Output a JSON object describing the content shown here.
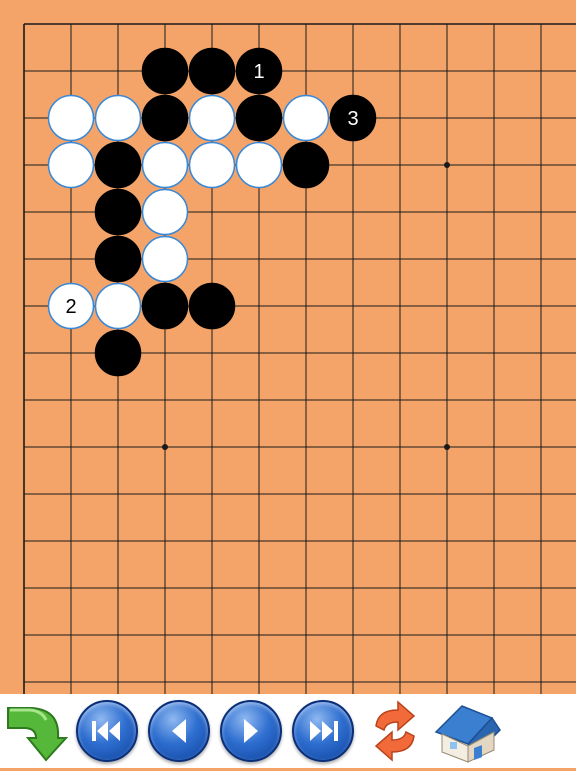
{
  "board": {
    "size": 19,
    "background_color": "#f4a468",
    "line_color": "#1a1a1a",
    "star_points": [
      [
        9,
        3
      ],
      [
        3,
        9
      ],
      [
        9,
        9
      ]
    ],
    "stones": [
      {
        "color": "black",
        "col": 3,
        "row": 1,
        "label": ""
      },
      {
        "color": "black",
        "col": 4,
        "row": 1,
        "label": ""
      },
      {
        "color": "black",
        "col": 5,
        "row": 1,
        "label": "1"
      },
      {
        "color": "white",
        "col": 1,
        "row": 2,
        "label": ""
      },
      {
        "color": "white",
        "col": 2,
        "row": 2,
        "label": ""
      },
      {
        "color": "black",
        "col": 3,
        "row": 2,
        "label": ""
      },
      {
        "color": "white",
        "col": 4,
        "row": 2,
        "label": ""
      },
      {
        "color": "black",
        "col": 5,
        "row": 2,
        "label": ""
      },
      {
        "color": "white",
        "col": 6,
        "row": 2,
        "label": ""
      },
      {
        "color": "black",
        "col": 7,
        "row": 2,
        "label": "3"
      },
      {
        "color": "white",
        "col": 1,
        "row": 3,
        "label": ""
      },
      {
        "color": "black",
        "col": 2,
        "row": 3,
        "label": ""
      },
      {
        "color": "white",
        "col": 3,
        "row": 3,
        "label": ""
      },
      {
        "color": "white",
        "col": 4,
        "row": 3,
        "label": ""
      },
      {
        "color": "white",
        "col": 5,
        "row": 3,
        "label": ""
      },
      {
        "color": "black",
        "col": 6,
        "row": 3,
        "label": ""
      },
      {
        "color": "black",
        "col": 2,
        "row": 4,
        "label": ""
      },
      {
        "color": "white",
        "col": 3,
        "row": 4,
        "label": ""
      },
      {
        "color": "black",
        "col": 2,
        "row": 5,
        "label": ""
      },
      {
        "color": "white",
        "col": 3,
        "row": 5,
        "label": ""
      },
      {
        "color": "white",
        "col": 1,
        "row": 6,
        "label": "2"
      },
      {
        "color": "white",
        "col": 2,
        "row": 6,
        "label": ""
      },
      {
        "color": "black",
        "col": 3,
        "row": 6,
        "label": ""
      },
      {
        "color": "black",
        "col": 4,
        "row": 6,
        "label": ""
      },
      {
        "color": "black",
        "col": 2,
        "row": 7,
        "label": ""
      }
    ]
  },
  "toolbar": {
    "buttons": [
      {
        "name": "undo-button",
        "icon": "curved-arrow-icon"
      },
      {
        "name": "first-move-button",
        "icon": "skip-to-start-icon"
      },
      {
        "name": "previous-move-button",
        "icon": "step-back-icon"
      },
      {
        "name": "next-move-button",
        "icon": "step-forward-icon"
      },
      {
        "name": "last-move-button",
        "icon": "skip-to-end-icon"
      },
      {
        "name": "reset-button",
        "icon": "refresh-arrows-icon"
      },
      {
        "name": "home-button",
        "icon": "house-icon"
      }
    ]
  }
}
